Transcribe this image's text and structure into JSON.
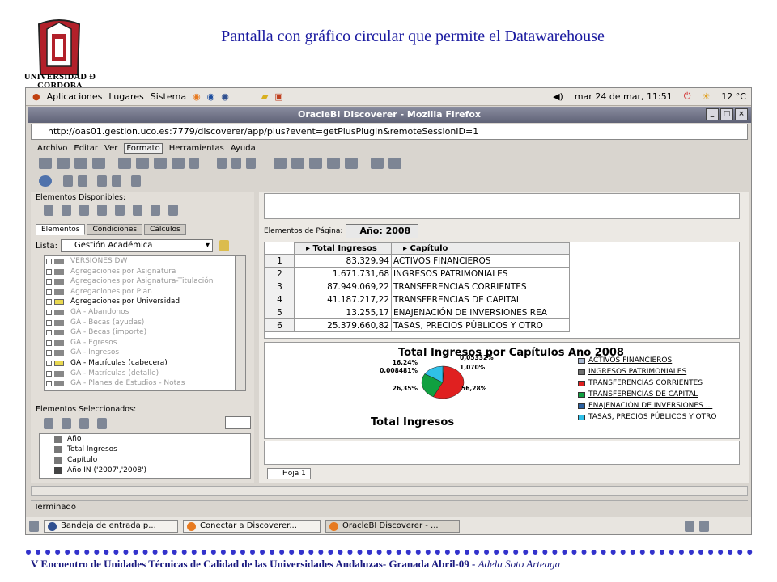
{
  "slide": {
    "logo_text": "UNIVERSIDAD Ð CORDOBA",
    "title": "Pantalla con gráfico circular que permite el Datawarehouse",
    "footer_main": "V Encuentro de Unidades Técnicas de Calidad de las Universidades Andaluzas- Granada Abril-09 - ",
    "footer_author": "Adela Soto Arteaga"
  },
  "gnome_panel": {
    "menus": [
      "Aplicaciones",
      "Lugares",
      "Sistema"
    ],
    "clock": "mar 24 de mar, 11:51",
    "temperature": "12 °C"
  },
  "window": {
    "title": "OracleBI Discoverer - Mozilla Firefox",
    "url": "http://oas01.gestion.uco.es:7779/discoverer/app/plus?event=getPlusPlugin&remoteSessionID=1",
    "menu": [
      "Archivo",
      "Editar",
      "Ver",
      "Formato",
      "Herramientas",
      "Ayuda"
    ],
    "status": "Terminado"
  },
  "left_panel": {
    "available_label": "Elementos Disponibles:",
    "tabs": [
      "Elementos",
      "Condiciones",
      "Cálculos"
    ],
    "lista_label": "Lista:",
    "lista_value": "Gestión Académica",
    "tree": [
      {
        "label": "VERSIONES DW",
        "dark": false
      },
      {
        "label": "Agregaciones por Asignatura",
        "dark": false
      },
      {
        "label": "Agregaciones por Asignatura-Titulación",
        "dark": false
      },
      {
        "label": "Agregaciones por Plan",
        "dark": false
      },
      {
        "label": "Agregaciones por Universidad",
        "dark": true
      },
      {
        "label": "GA - Abandonos",
        "dark": false
      },
      {
        "label": "GA - Becas (ayudas)",
        "dark": false
      },
      {
        "label": "GA - Becas (importe)",
        "dark": false
      },
      {
        "label": "GA - Egresos",
        "dark": false
      },
      {
        "label": "GA - Ingresos",
        "dark": false
      },
      {
        "label": "GA - Matrículas (cabecera)",
        "dark": true
      },
      {
        "label": "GA - Matrículas (detalle)",
        "dark": false
      },
      {
        "label": "GA - Planes de Estudios - Notas",
        "dark": false
      }
    ],
    "selected_label": "Elementos Seleccionados:",
    "selected": [
      "Año",
      "Total Ingresos",
      "Capítulo",
      "Año IN ('2007','2008')"
    ]
  },
  "right_panel": {
    "page_items_label": "Elementos de Página:",
    "page_item_value": "Año: 2008",
    "sheet_tab": "Hoja 1"
  },
  "table": {
    "headers": [
      "Total Ingresos",
      "Capítulo"
    ],
    "rows": [
      {
        "n": "1",
        "total": "83.329,94",
        "capitulo": "ACTIVOS FINANCIEROS"
      },
      {
        "n": "2",
        "total": "1.671.731,68",
        "capitulo": "INGRESOS PATRIMONIALES"
      },
      {
        "n": "3",
        "total": "87.949.069,22",
        "capitulo": "TRANSFERENCIAS CORRIENTES"
      },
      {
        "n": "4",
        "total": "41.187.217,22",
        "capitulo": "TRANSFERENCIAS DE CAPITAL"
      },
      {
        "n": "5",
        "total": "13.255,17",
        "capitulo": "ENAJENACIÓN DE INVERSIONES REA"
      },
      {
        "n": "6",
        "total": "25.379.660,82",
        "capitulo": "TASAS, PRECIOS PÚBLICOS Y OTRO"
      }
    ]
  },
  "chart_data": {
    "type": "pie",
    "title": "Total Ingresos por Capítulos Año 2008",
    "subtitle": "Total Ingresos",
    "slices": [
      {
        "label": "ACTIVOS FINANCIEROS",
        "value": 0.05332,
        "display": "0,05332%",
        "color": "#a7b7d0"
      },
      {
        "label": "INGRESOS PATRIMONIALES",
        "value": 1.07,
        "display": "1,070%",
        "color": "#707070"
      },
      {
        "label": "TRANSFERENCIAS CORRIENTES",
        "value": 56.28,
        "display": "56,28%",
        "color": "#e02020"
      },
      {
        "label": "TRANSFERENCIAS DE CAPITAL",
        "value": 26.35,
        "display": "26,35%",
        "color": "#10a040"
      },
      {
        "label": "ENAJENACIÓN DE INVERSIONES ...",
        "value": 0.008481,
        "display": "0,008481%",
        "color": "#2a60a0"
      },
      {
        "label": "TASAS, PRECIOS PÚBLICOS Y OTRO",
        "value": 16.24,
        "display": "16,24%",
        "color": "#30c0e8"
      }
    ]
  },
  "taskbar": [
    "Bandeja de entrada p...",
    "Conectar a Discoverer...",
    "OracleBI Discoverer - ..."
  ]
}
